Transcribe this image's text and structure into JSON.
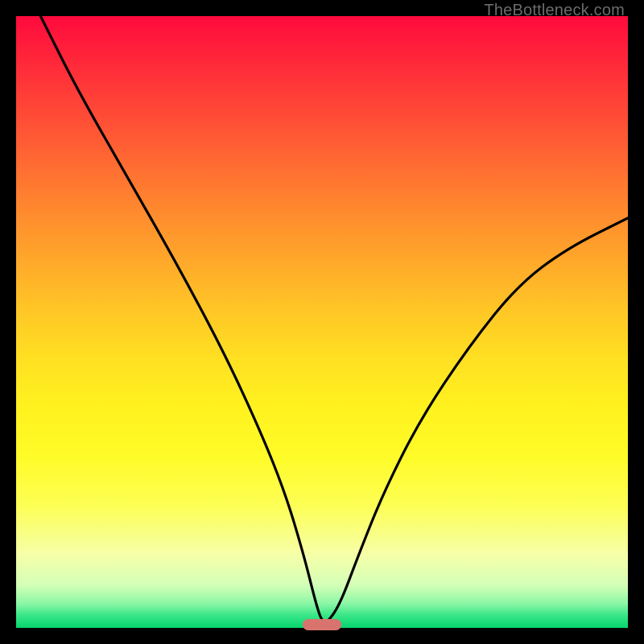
{
  "watermark": "TheBottleneck.com",
  "chart_data": {
    "type": "line",
    "title": "",
    "xlabel": "",
    "ylabel": "",
    "xlim": [
      0,
      100
    ],
    "ylim": [
      0,
      100
    ],
    "grid": false,
    "series": [
      {
        "name": "bottleneck-curve",
        "x": [
          4,
          10,
          18,
          26,
          34,
          40,
          44,
          47,
          49,
          50,
          51,
          53,
          56,
          60,
          66,
          74,
          82,
          90,
          100
        ],
        "y": [
          100,
          88,
          74,
          60,
          45,
          32,
          22,
          12,
          4,
          1,
          1,
          4,
          12,
          22,
          34,
          46,
          56,
          62,
          67
        ]
      }
    ],
    "marker": {
      "x": 50,
      "y": 0.5
    },
    "background_gradient": {
      "top": "#ff0a3c",
      "mid": "#fff21f",
      "bottom": "#06d46e"
    }
  }
}
